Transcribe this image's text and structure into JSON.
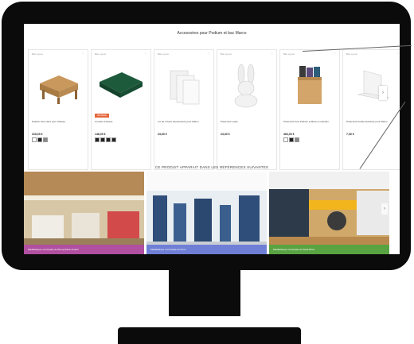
{
  "section_title": "Accessoires pour Podium et bac Marco",
  "products": [
    {
      "tag": "Bac a jeux",
      "name": "Podium bois carré pour chaises",
      "price": "315,00 €",
      "swatches": [
        "#ffffff",
        "#222222",
        "#888888"
      ],
      "promo": ""
    },
    {
      "tag": "Bac a jeux",
      "name": "Coussin d'assise",
      "price": "146,00 €",
      "swatches": [
        "#222222",
        "#222222",
        "#222222",
        "#222222"
      ],
      "promo": "NOUVEAU"
    },
    {
      "tag": "Bac a jeux",
      "name": "Lot de 3 bacs transparents pour Marco",
      "price": "23,00 €",
      "swatches": [],
      "promo": ""
    },
    {
      "tag": "Bac a jeux",
      "name": "Présentoir Lapin",
      "price": "23,00 €",
      "swatches": [],
      "promo": ""
    },
    {
      "tag": "Bac a jeux",
      "name": "Présentoir bois Podium et Bacs à roulettes",
      "price": "364,00 €",
      "swatches": [
        "#ffffff",
        "#222222",
        "#888888"
      ],
      "promo": ""
    },
    {
      "tag": "Bac a jeux",
      "name": "Présentoir bande dessinée pour Marco",
      "price": "7,00 €",
      "swatches": [],
      "promo": ""
    }
  ],
  "next_arrow": "›",
  "refs_title": "CE PRODUIT APPARAIT DANS LES RÉFÉRENCES SUIVANTES",
  "references": [
    {
      "caption": "Médiathèque municipale de Bourg-Saint-Andéol",
      "color": "#b14fa0"
    },
    {
      "caption": "Médiathèque municipale de Pons",
      "color": "#6f7fd6"
    },
    {
      "caption": "Médiathèque municipale de Saint-Brice",
      "color": "#5aa342"
    }
  ],
  "ref_arrow": "›",
  "heart": "♡"
}
